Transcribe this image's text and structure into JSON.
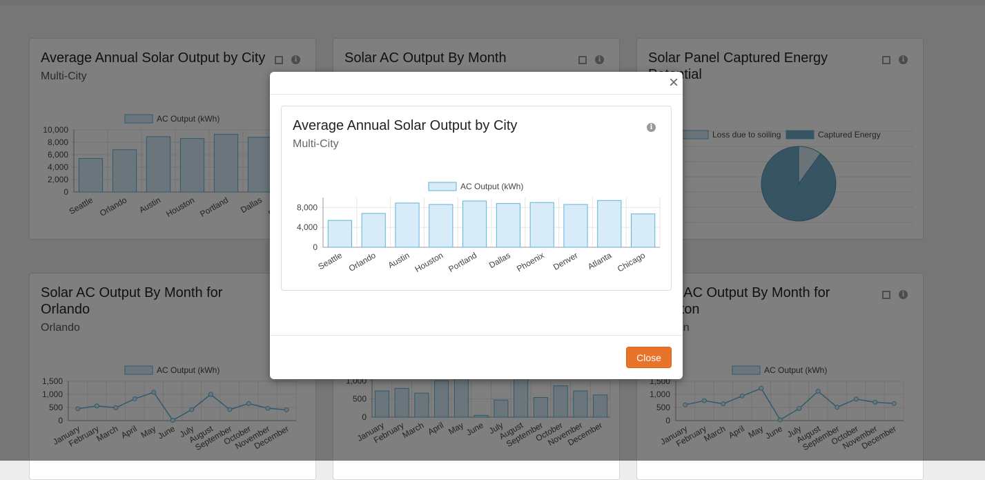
{
  "colors": {
    "accent": "#e8732a",
    "bar_fill": "#d7ecf8",
    "bar_stroke": "#5eb3d6",
    "pie_captured": "#6fa8c7",
    "pie_loss": "#d4e6f0"
  },
  "cards": [
    {
      "title": "Average Annual Solar Output by City",
      "subtitle": "Multi-City"
    },
    {
      "title": "Solar AC Output By Month",
      "subtitle": ""
    },
    {
      "title": "Solar Panel Captured Energy Potential",
      "subtitle": ""
    },
    {
      "title": "Solar AC Output By Month for Orlando",
      "subtitle": "Orlando"
    },
    {
      "title": "",
      "subtitle": ""
    },
    {
      "title": "Solar AC Output By Month for Houston",
      "subtitle": "Houston"
    }
  ],
  "modal": {
    "close_x": "×",
    "title": "Average Annual Solar Output by City",
    "subtitle": "Multi-City",
    "close_label": "Close"
  },
  "chart_data": [
    {
      "id": "modal",
      "type": "bar",
      "legend": "AC Output (kWh)",
      "categories": [
        "Seattle",
        "Orlando",
        "Austin",
        "Houston",
        "Portland",
        "Dallas",
        "Phoenix",
        "Denver",
        "Atlanta",
        "Chicago"
      ],
      "values": [
        5400,
        6800,
        8900,
        8600,
        9300,
        8800,
        9000,
        8600,
        9400,
        6700
      ],
      "yticks": [
        "0",
        "4,000",
        "8,000"
      ],
      "ylim": [
        0,
        10000
      ]
    },
    {
      "id": "card1",
      "type": "bar",
      "legend": "AC Output (kWh)",
      "categories": [
        "Seattle",
        "Orlando",
        "Austin",
        "Houston",
        "Portland",
        "Dallas",
        "Phoenix",
        "Denver",
        "Atlanta",
        "Chicago"
      ],
      "values": [
        5400,
        6800,
        8900,
        8600,
        9300,
        8800,
        9000,
        8600,
        9400,
        6700
      ],
      "yticks": [
        "0",
        "2,000",
        "4,000",
        "6,000",
        "8,000",
        "10,000"
      ],
      "ylim": [
        0,
        10000
      ]
    },
    {
      "id": "card3",
      "type": "pie",
      "legend": [
        "Loss due to soiling",
        "Captured Energy"
      ],
      "values": [
        10,
        90
      ]
    },
    {
      "id": "card4",
      "type": "line",
      "legend": "AC Output (kWh)",
      "categories": [
        "January",
        "February",
        "March",
        "April",
        "May",
        "June",
        "July",
        "August",
        "September",
        "October",
        "November",
        "December"
      ],
      "values": [
        450,
        560,
        490,
        830,
        1080,
        10,
        420,
        1000,
        420,
        650,
        470,
        410
      ],
      "yticks": [
        "0",
        "500",
        "1,000",
        "1,500"
      ],
      "ylim": [
        0,
        1500
      ]
    },
    {
      "id": "card5",
      "type": "bar",
      "categories": [
        "January",
        "February",
        "March",
        "April",
        "May",
        "June",
        "July",
        "August",
        "September",
        "October",
        "November",
        "December"
      ],
      "values": [
        720,
        790,
        660,
        1000,
        1300,
        50,
        470,
        1300,
        540,
        860,
        720,
        610
      ],
      "yticks": [
        "0",
        "500",
        "1,000"
      ],
      "ylim": [
        0,
        1100
      ]
    },
    {
      "id": "card6",
      "type": "line",
      "legend": "AC Output (kWh)",
      "categories": [
        "January",
        "February",
        "March",
        "April",
        "May",
        "June",
        "July",
        "August",
        "September",
        "October",
        "November",
        "December"
      ],
      "values": [
        600,
        760,
        640,
        940,
        1230,
        30,
        460,
        1120,
        510,
        820,
        700,
        650
      ],
      "yticks": [
        "0",
        "500",
        "1,000",
        "1,500"
      ],
      "ylim": [
        0,
        1500
      ]
    }
  ]
}
